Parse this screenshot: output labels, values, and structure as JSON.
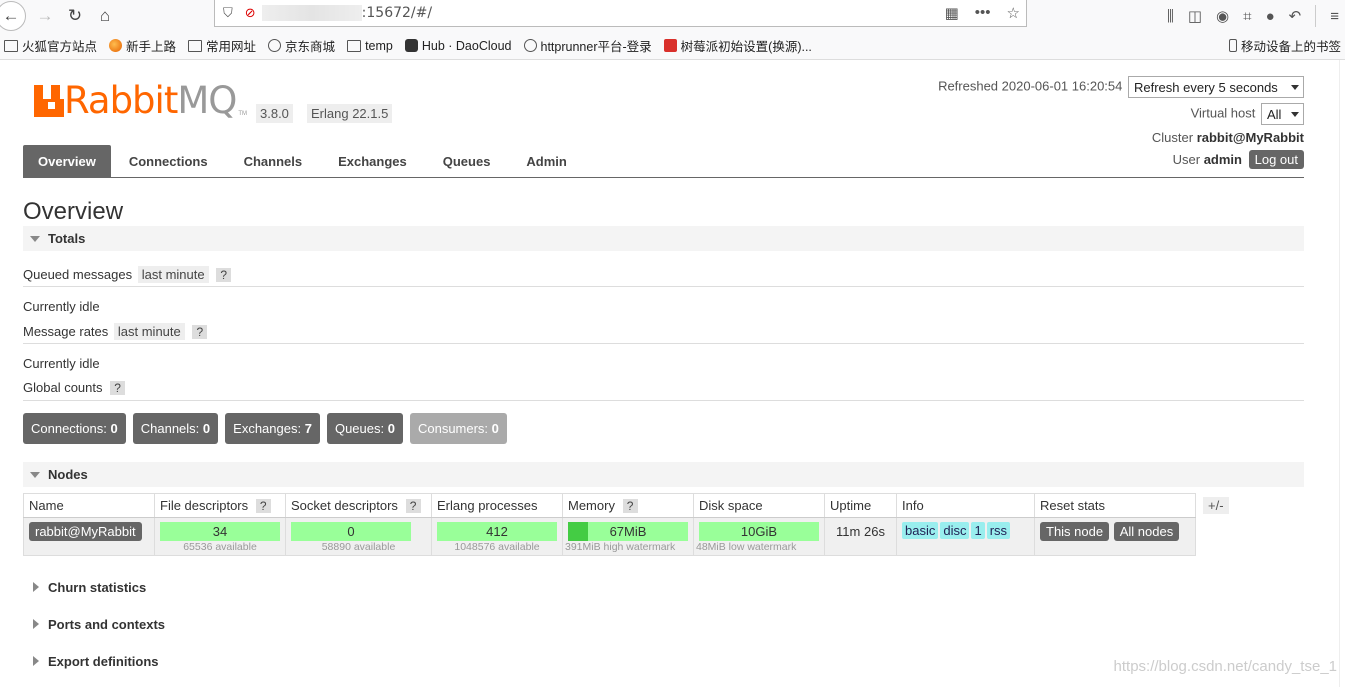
{
  "browser": {
    "url_suffix": ":15672/#/",
    "bookmarks": [
      {
        "label": "火狐官方站点",
        "icon": "folder-icon"
      },
      {
        "label": "新手上路",
        "icon": "firefox-icon"
      },
      {
        "label": "常用网址",
        "icon": "folder-icon"
      },
      {
        "label": "京东商城",
        "icon": "globe-icon"
      },
      {
        "label": "temp",
        "icon": "folder-icon"
      },
      {
        "label": "Hub · DaoCloud",
        "icon": "hub-icon"
      },
      {
        "label": "httprunner平台-登录",
        "icon": "globe-icon"
      },
      {
        "label": "树莓派初始设置(换源)...",
        "icon": "red-square-icon"
      }
    ],
    "mobile_bookmarks": "移动设备上的书签"
  },
  "header": {
    "logo_rabbit": "Rabbit",
    "logo_mq": "MQ",
    "logo_tm": "TM",
    "version": "3.8.0",
    "erlang": "Erlang 22.1.5",
    "refreshed_label": "Refreshed 2020-06-01 16:20:54",
    "refresh_select": "Refresh every 5 seconds",
    "vhost_label": "Virtual host",
    "vhost_value": "All",
    "cluster_label": "Cluster",
    "cluster_value": "rabbit@MyRabbit",
    "user_label": "User",
    "user_value": "admin",
    "logout": "Log out"
  },
  "tabs": [
    "Overview",
    "Connections",
    "Channels",
    "Exchanges",
    "Queues",
    "Admin"
  ],
  "overview": {
    "title": "Overview",
    "totals_section": "Totals",
    "queued_label": "Queued messages",
    "queued_chip": "last minute",
    "help": "?",
    "idle1": "Currently idle",
    "rates_label": "Message rates",
    "rates_chip": "last minute",
    "idle2": "Currently idle",
    "global_label": "Global counts",
    "counts": {
      "connections_label": "Connections:",
      "connections": "0",
      "channels_label": "Channels:",
      "channels": "0",
      "exchanges_label": "Exchanges:",
      "exchanges": "7",
      "queues_label": "Queues:",
      "queues": "0",
      "consumers_label": "Consumers:",
      "consumers": "0"
    },
    "nodes_section": "Nodes",
    "nodes_headers": [
      "Name",
      "File descriptors",
      "Socket descriptors",
      "Erlang processes",
      "Memory",
      "Disk space",
      "Uptime",
      "Info",
      "Reset stats"
    ],
    "plusminus": "+/-",
    "node": {
      "name": "rabbit@MyRabbit",
      "fd": "34",
      "fd_sub": "65536 available",
      "fd_fraction": 0.0005,
      "sockets": "0",
      "sockets_sub": "58890 available",
      "sockets_fraction": 0,
      "procs": "412",
      "procs_sub": "1048576 available",
      "procs_fraction": 0.0004,
      "memory": "67MiB",
      "memory_sub": "391MiB high watermark",
      "memory_fraction": 0.17,
      "disk": "10GiB",
      "disk_sub": "48MiB low watermark",
      "uptime": "11m 26s",
      "info": [
        "basic",
        "disc",
        "1",
        "rss"
      ],
      "reset_this": "This node",
      "reset_all": "All nodes"
    },
    "churn": "Churn statistics",
    "ports": "Ports and contexts",
    "export": "Export definitions"
  },
  "watermark": "https://blog.csdn.net/candy_tse_1"
}
